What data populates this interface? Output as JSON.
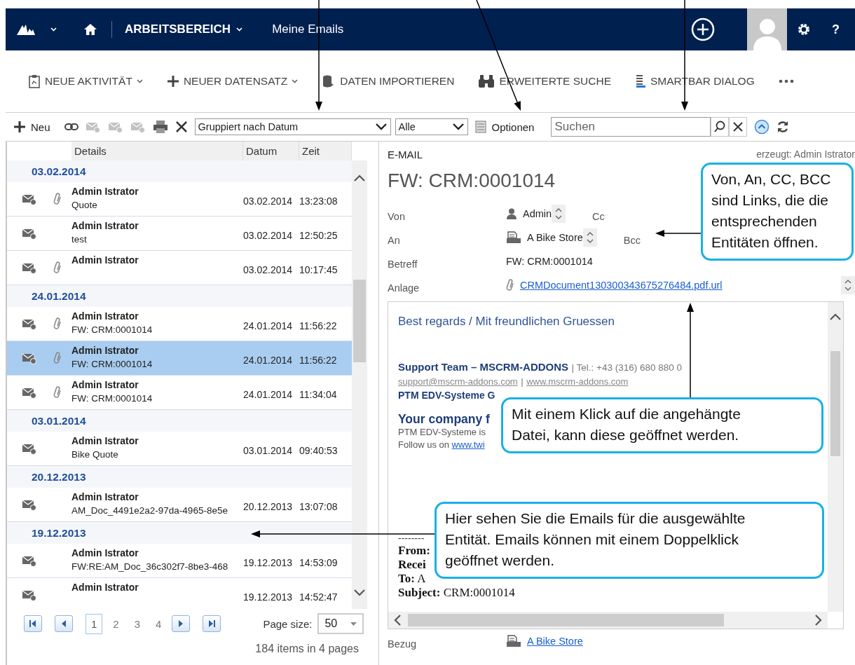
{
  "nav": {
    "workspace": "ARBEITSBEREICH",
    "page": "Meine Emails",
    "help": "?"
  },
  "commands": [
    {
      "label": "NEUE AKTIVITÄT",
      "kind": "activity",
      "dropdown": true
    },
    {
      "label": "NEUER DATENSATZ",
      "kind": "record",
      "dropdown": true
    },
    {
      "label": "DATEN IMPORTIEREN",
      "kind": "import",
      "dropdown": false
    },
    {
      "label": "ERWEITERTE SUCHE",
      "kind": "search",
      "dropdown": false
    },
    {
      "label": "SMARTBAR DIALOG",
      "kind": "smartbar",
      "dropdown": false
    }
  ],
  "toolbar": {
    "new": "Neu",
    "view": "Gruppiert nach Datum",
    "filter": "Alle",
    "options": "Optionen",
    "search_placeholder": "Suchen"
  },
  "grid": {
    "columns": [
      "Details",
      "Datum",
      "Zeit"
    ],
    "groups": [
      {
        "date": "03.02.2014",
        "rows": [
          {
            "sender": "Admin Istrator",
            "subject": "Quote",
            "date": "03.02.2014",
            "time": "13:23:08",
            "attachment": true,
            "selected": false
          },
          {
            "sender": "Admin Istrator",
            "subject": "test",
            "date": "03.02.2014",
            "time": "12:50:25",
            "attachment": false,
            "selected": false
          },
          {
            "sender": "Admin Istrator",
            "date": "03.02.2014",
            "time": "10:17:45",
            "attachment": true,
            "selected": false
          }
        ]
      },
      {
        "date": "24.01.2014",
        "rows": [
          {
            "sender": "Admin Istrator",
            "subject": "FW: CRM:0001014",
            "date": "24.01.2014",
            "time": "11:56:22",
            "attachment": true,
            "selected": false
          },
          {
            "sender": "Admin Istrator",
            "subject": "FW: CRM:0001014",
            "date": "24.01.2014",
            "time": "11:56:22",
            "attachment": true,
            "selected": true
          },
          {
            "sender": "Admin Istrator",
            "subject": "FW: CRM:0001014",
            "date": "24.01.2014",
            "time": "11:34:04",
            "attachment": true,
            "selected": false
          }
        ]
      },
      {
        "date": "03.01.2014",
        "rows": [
          {
            "sender": "Admin Istrator",
            "subject": "Bike Quote",
            "date": "03.01.2014",
            "time": "09:40:53",
            "attachment": false,
            "selected": false
          }
        ]
      },
      {
        "date": "20.12.2013",
        "rows": [
          {
            "sender": "Admin Istrator",
            "subject": "AM_Doc_4491e2a2-97da-4965-8e5e",
            "date": "20.12.2013",
            "time": "13:07:08",
            "attachment": false,
            "selected": false
          }
        ]
      },
      {
        "date": "19.12.2013",
        "rows": [
          {
            "sender": "Admin Istrator",
            "subject": "FW:RE:AM_Doc_36c302f7-8be3-468",
            "date": "19.12.2013",
            "time": "14:53:09",
            "attachment": false,
            "selected": false
          },
          {
            "sender": "Admin Istrator",
            "date": "19.12.2013",
            "time": "14:52:47",
            "attachment": false,
            "selected": false
          }
        ]
      }
    ]
  },
  "pager": {
    "pages": [
      {
        "label": "1",
        "selected": true
      },
      {
        "label": "2",
        "selected": false
      },
      {
        "label": "3",
        "selected": false
      },
      {
        "label": "4",
        "selected": false
      }
    ],
    "page_size_label": "Page size:",
    "page_size": "50",
    "summary": "184 items in 4 pages"
  },
  "email": {
    "type_label": "E-MAIL",
    "created_by": "erzeugt: Admin Istrator",
    "title": "FW: CRM:0001014",
    "fields": [
      {
        "label": "Von",
        "kind": "person",
        "value": "Admin",
        "side_label": "Cc"
      },
      {
        "label": "An",
        "kind": "account",
        "value": "A Bike Store",
        "side_label": "Bcc"
      },
      {
        "label": "Betreff",
        "kind": "text",
        "value": "FW: CRM:0001014"
      },
      {
        "label": "Anlage",
        "kind": "attachment",
        "value": "CRMDocument130300343675276484.pdf.url"
      }
    ],
    "body": {
      "greeting": "Best regards / Mit freundlichen Gruessen",
      "signature_name": "Support Team – MSCRM-ADDONS",
      "signature_tel": "| Tel.: +43 (316) 680 880 0",
      "email_link": "support@mscrm-addons.com",
      "link_separator": "|",
      "web_link": "www.mscrm-addons.com",
      "company": "PTM EDV-Systeme G",
      "slogan": "Your company f",
      "company_text": "PTM EDV-Systeme is",
      "follow": "Follow us on",
      "follow_link": "www.twi",
      "dashes": "--------",
      "header_lines": [
        {
          "label": "From:"
        },
        {
          "label": "Recei"
        },
        {
          "label": "To:",
          "value": "A"
        },
        {
          "label": "Subject:",
          "value": "CRM:0001014"
        }
      ]
    },
    "regarding": {
      "label": "Bezug",
      "value": "A Bike Store"
    }
  },
  "callouts": [
    {
      "text": "Von, An, CC, BCC sind Links, die die entsprechenden Entitäten öffnen."
    },
    {
      "text": "Mit einem Klick auf die angehängte Datei, kann diese geöffnet werden."
    },
    {
      "text": "Hier sehen Sie die Emails für die ausgewählte Entität. Emails können mit einem Doppelklick geöffnet werden."
    }
  ]
}
